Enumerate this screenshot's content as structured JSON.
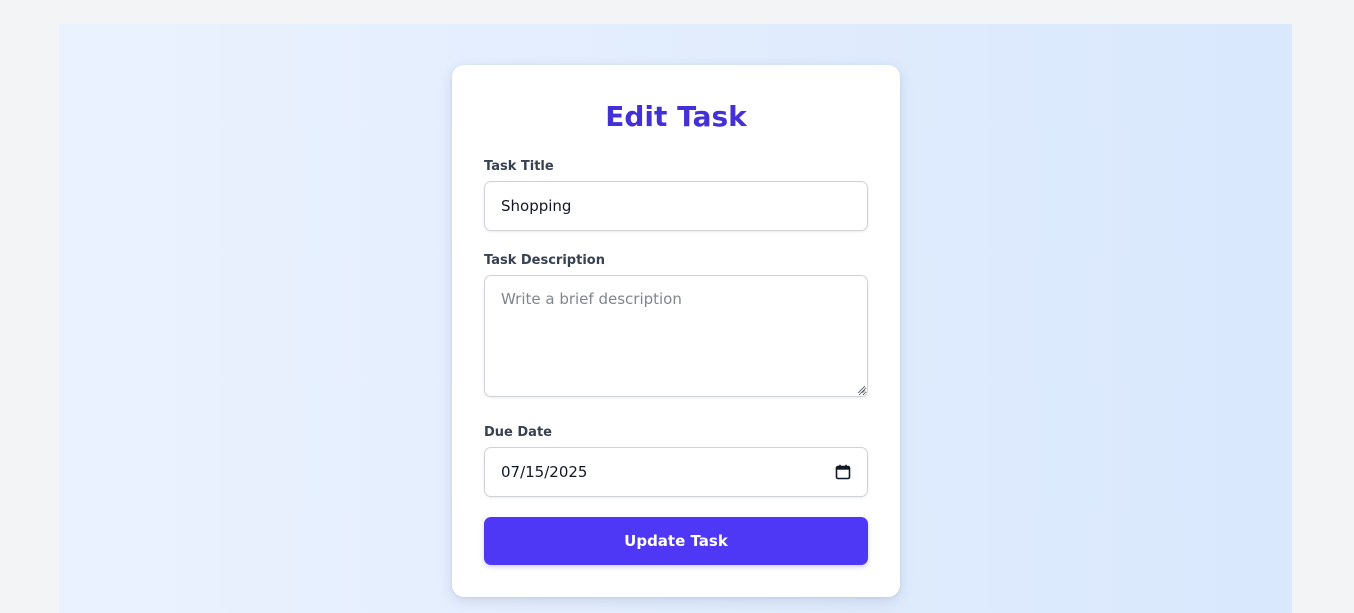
{
  "form": {
    "heading": "Edit Task",
    "title_label": "Task Title",
    "title_value": "Shopping",
    "description_label": "Task Description",
    "description_value": "",
    "description_placeholder": "Write a brief description",
    "due_date_label": "Due Date",
    "due_date_value": "07/15/2025",
    "submit_label": "Update Task"
  },
  "icons": {
    "due_date_picker": "calendar-icon",
    "textarea_resize": "resize-grip-icon"
  },
  "colors": {
    "accent": "#4f38f5",
    "heading": "#4330d6",
    "page_background": "#f2f4f6",
    "card_background": "#ffffff"
  }
}
